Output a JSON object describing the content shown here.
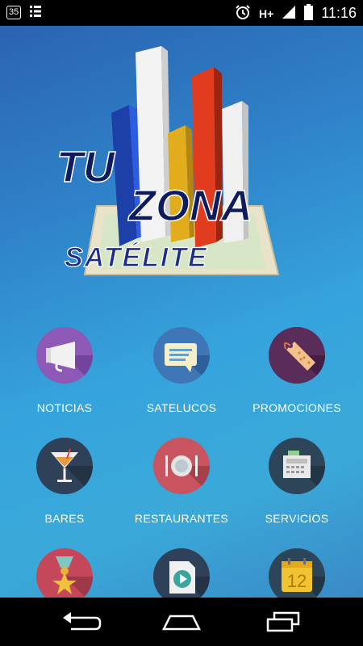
{
  "status_bar": {
    "badge": "35",
    "network": "H+",
    "time": "11:16"
  },
  "logo": {
    "line1": "TU",
    "line2": "ZONA",
    "line3": "SATÉLITE"
  },
  "menu": {
    "items": [
      {
        "label": "NOTICIAS",
        "icon": "megaphone-icon",
        "color": "#8e59b6"
      },
      {
        "label": "SATELUCOS",
        "icon": "chat-icon",
        "color": "#3e76b6"
      },
      {
        "label": "PROMOCIONES",
        "icon": "tag-icon",
        "color": "#5a2c5a"
      },
      {
        "label": "BARES",
        "icon": "cocktail-icon",
        "color": "#2f4158"
      },
      {
        "label": "RESTAURANTES",
        "icon": "plate-icon",
        "color": "#c8545f"
      },
      {
        "label": "SERVICIOS",
        "icon": "cash-register-icon",
        "color": "#2d4559"
      },
      {
        "label": "",
        "icon": "medal-icon",
        "color": "#c4485a"
      },
      {
        "label": "",
        "icon": "play-icon",
        "color": "#2f4158"
      },
      {
        "label": "",
        "icon": "calendar-icon",
        "color": "#2d4559"
      }
    ]
  },
  "calendar_number": "12"
}
